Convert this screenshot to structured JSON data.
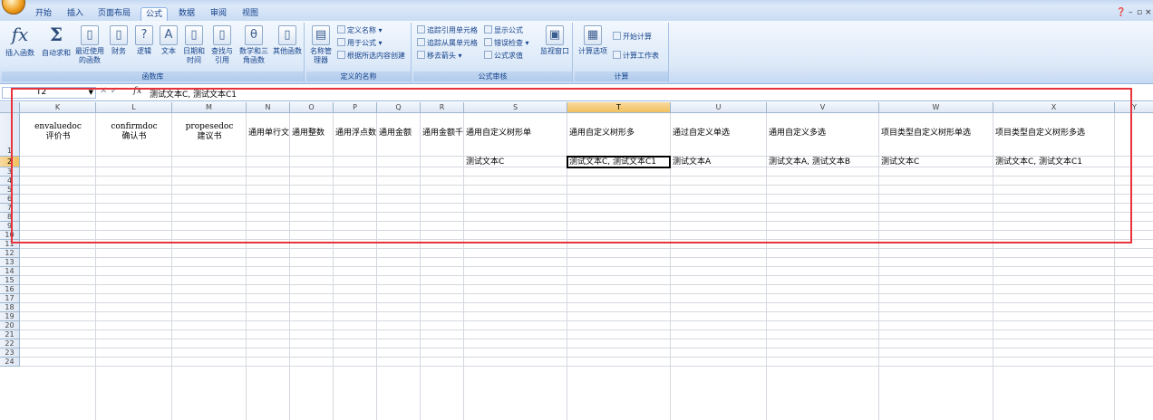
{
  "ribbon_tabs": [
    "开始",
    "插入",
    "页面布局",
    "公式",
    "数据",
    "审阅",
    "视图"
  ],
  "active_tab": "公式",
  "groups": {
    "function_library": {
      "label": "函数库",
      "insert_function": "插入函数",
      "autosum": "自动求和",
      "recent": "最近使用的函数",
      "financial": "财务",
      "logical": "逻辑",
      "text": "文本",
      "datetime": "日期和时间",
      "lookup": "查找与引用",
      "math": "数学和三角函数",
      "more": "其他函数"
    },
    "defined_names": {
      "label": "定义的名称",
      "name_manager": "名称管理器",
      "define_name": "定义名称",
      "use_in_formula": "用于公式",
      "create_from_selection": "根据所选内容创建"
    },
    "formula_auditing": {
      "label": "公式审核",
      "trace_precedents": "追踪引用单元格",
      "trace_dependents": "追踪从属单元格",
      "remove_arrows": "移去箭头",
      "show_formulas": "显示公式",
      "error_checking": "错误检查",
      "evaluate_formula": "公式求值",
      "watch_window": "监视窗口"
    },
    "calculation": {
      "label": "计算",
      "calc_options": "计算选项",
      "calc_now": "开始计算",
      "calc_sheet": "计算工作表"
    }
  },
  "formula_bar": {
    "name_box": "T2",
    "fx": "fx",
    "content": "测试文本C, 测试文本C1"
  },
  "columns": [
    "K",
    "L",
    "M",
    "N",
    "O",
    "P",
    "Q",
    "R",
    "S",
    "T",
    "U",
    "V",
    "W",
    "X",
    "Y"
  ],
  "selected_column": "T",
  "rows": [
    "1",
    "2",
    "3",
    "4",
    "5",
    "6",
    "7",
    "8",
    "9",
    "10",
    "11",
    "12",
    "13",
    "14",
    "15",
    "16",
    "17",
    "18",
    "19",
    "20",
    "21",
    "22",
    "23",
    "24"
  ],
  "selected_row": "2",
  "header_row": {
    "K": "envaluedoc\n评价书",
    "L": "confirmdoc\n确认书",
    "M": "propesedoc\n建议书",
    "N": "通用单行文",
    "O": "通用整数",
    "P": "通用浮点数",
    "Q": "通用金额",
    "R": "通用金额千",
    "S": "通用自定义树形单",
    "T": "通用自定义树形多",
    "U": "通过自定义单选",
    "V": "通用自定义多选",
    "W": "项目类型自定义树形单选",
    "X": "项目类型自定义树形多选"
  },
  "data_row": {
    "S": "测试文本C",
    "T": "测试文本C, 测试文本C1",
    "U": "测试文本A",
    "V": "测试文本A, 测试文本B",
    "W": "测试文本C",
    "X": "测试文本C, 测试文本C1"
  },
  "colors": {
    "highlight_box": "#e8333b",
    "selected_header": "#f1c15f"
  }
}
